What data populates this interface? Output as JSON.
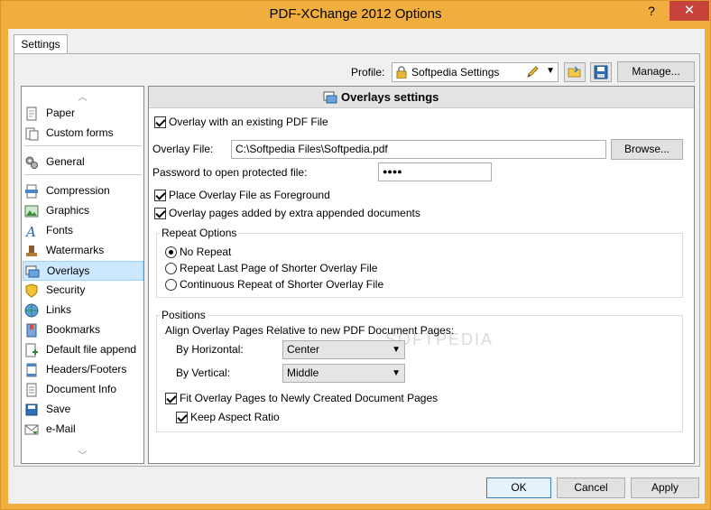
{
  "window": {
    "title": "PDF-XChange 2012 Options",
    "help_glyph": "?",
    "close_glyph": "✕"
  },
  "tabs": [
    {
      "label": "Settings"
    }
  ],
  "profile": {
    "label": "Profile:",
    "value": "Softpedia Settings",
    "manage_label": "Manage..."
  },
  "sidebar": {
    "items": [
      {
        "label": "Paper",
        "icon": "paper-icon"
      },
      {
        "label": "Custom forms",
        "icon": "custom-forms-icon"
      },
      {
        "label": "General",
        "icon": "gears-icon"
      },
      {
        "label": "Compression",
        "icon": "compression-icon"
      },
      {
        "label": "Graphics",
        "icon": "graphics-icon"
      },
      {
        "label": "Fonts",
        "icon": "fonts-icon"
      },
      {
        "label": "Watermarks",
        "icon": "watermark-icon"
      },
      {
        "label": "Overlays",
        "icon": "overlays-icon"
      },
      {
        "label": "Security",
        "icon": "shield-icon"
      },
      {
        "label": "Links",
        "icon": "links-icon"
      },
      {
        "label": "Bookmarks",
        "icon": "bookmarks-icon"
      },
      {
        "label": "Default file append",
        "icon": "file-append-icon"
      },
      {
        "label": "Headers/Footers",
        "icon": "headers-footers-icon"
      },
      {
        "label": "Document Info",
        "icon": "document-info-icon"
      },
      {
        "label": "Save",
        "icon": "save-icon"
      },
      {
        "label": "e-Mail",
        "icon": "email-icon"
      }
    ],
    "selected": "Overlays",
    "up_glyph": "︿",
    "down_glyph": "﹀"
  },
  "panel": {
    "title": "Overlays settings",
    "overlay_existing": {
      "label": "Overlay with an existing PDF File",
      "checked": true
    },
    "overlay_file": {
      "label": "Overlay File:",
      "value": "C:\\Softpedia Files\\Softpedia.pdf",
      "browse_label": "Browse..."
    },
    "password": {
      "label": "Password to open protected file:",
      "value": "●●●●"
    },
    "foreground": {
      "label": "Place Overlay File as Foreground",
      "checked": true
    },
    "extra_pages": {
      "label": "Overlay pages added by extra appended documents",
      "checked": true
    },
    "repeat": {
      "title": "Repeat Options",
      "options": [
        {
          "label": "No Repeat",
          "selected": true
        },
        {
          "label": "Repeat Last Page of Shorter Overlay File",
          "selected": false
        },
        {
          "label": "Continuous Repeat of Shorter Overlay File",
          "selected": false
        }
      ]
    },
    "positions": {
      "title": "Positions",
      "align_label": "Align Overlay Pages Relative to new PDF Document Pages:",
      "horizontal_label": "By Horizontal:",
      "horizontal_value": "Center",
      "vertical_label": "By Vertical:",
      "vertical_value": "Middle",
      "fit": {
        "label": "Fit Overlay Pages to Newly Created Document Pages",
        "checked": true
      },
      "aspect": {
        "label": "Keep Aspect Ratio",
        "checked": true
      }
    },
    "watermark_text": "SOFTPEDIA"
  },
  "footer": {
    "ok_label": "OK",
    "cancel_label": "Cancel",
    "apply_label": "Apply"
  },
  "colors": {
    "titlebar": "#f0ae3e",
    "close": "#c7423a",
    "selection": "#cce8ff"
  }
}
